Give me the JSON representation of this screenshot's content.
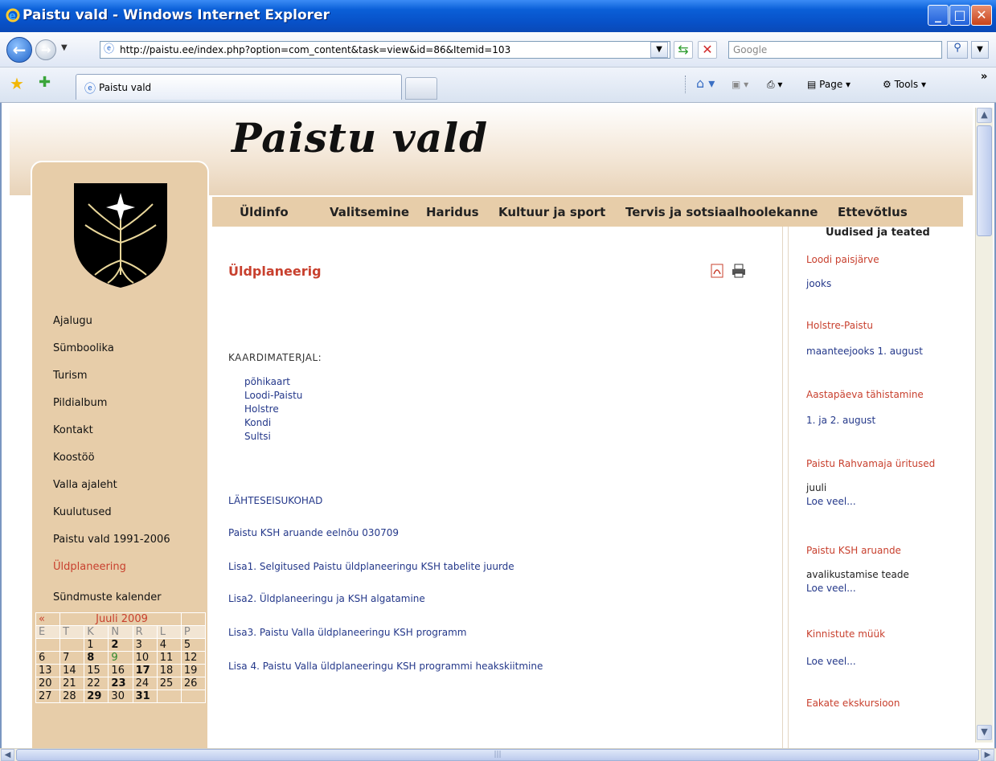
{
  "window": {
    "title": "Paistu vald - Windows Internet Explorer"
  },
  "address_bar": {
    "url": "http://paistu.ee/index.php?option=com_content&task=view&id=86&Itemid=103",
    "search_placeholder": "Google"
  },
  "tabs": {
    "active_label": "Paistu vald"
  },
  "command_bar": {
    "page_label": "Page",
    "tools_label": "Tools"
  },
  "site": {
    "title": "Paistu vald"
  },
  "top_nav": [
    "Üldinfo",
    "Valitsemine",
    "Haridus",
    "Kultuur ja sport",
    "Tervis ja sotsiaalhoolekanne",
    "Ettevõtlus"
  ],
  "left_menu": {
    "items": [
      "Ajalugu",
      "Sümboolika",
      "Turism",
      "Pildialbum",
      "Kontakt",
      "Koostöö",
      "Valla ajaleht",
      "Kuulutused",
      "Paistu vald 1991-2006",
      "Üldplaneering",
      "Sündmuste kalender"
    ],
    "active": "Üldplaneering"
  },
  "calendar": {
    "prev": "«",
    "month": "Juuli 2009",
    "weekdays": [
      "E",
      "T",
      "K",
      "N",
      "R",
      "L",
      "P"
    ],
    "weeks": [
      [
        "",
        "",
        "1",
        "2",
        "3",
        "4",
        "5"
      ],
      [
        "6",
        "7",
        "8",
        "9",
        "10",
        "11",
        "12"
      ],
      [
        "13",
        "14",
        "15",
        "16",
        "17",
        "18",
        "19"
      ],
      [
        "20",
        "21",
        "22",
        "23",
        "24",
        "25",
        "26"
      ],
      [
        "27",
        "28",
        "29",
        "30",
        "31",
        "",
        ""
      ]
    ]
  },
  "article": {
    "title": "Üldplaneerig",
    "maps_heading": "KAARDIMATERJAL:",
    "map_links": [
      "põhikaart",
      "Loodi-Paistu",
      "Holstre",
      "Kondi",
      "Sultsi"
    ],
    "doc_links": [
      "LÄHTESEISUKOHAD",
      "Paistu KSH aruande eelnõu 030709",
      "Lisa1. Selgitused Paistu üldplaneeringu KSH tabelite juurde",
      "Lisa2. Üldplaneeringu ja KSH algatamine",
      "Lisa3.  Paistu Valla üldplaneeringu KSH programm",
      "Lisa 4. Paistu Valla üldplaneeringu KSH programmi heakskiitmine"
    ]
  },
  "news": {
    "heading": "Uudised ja teated",
    "items": [
      {
        "text": "Loodi paisjärve",
        "style": "red"
      },
      {
        "text": "jooks",
        "style": "blue"
      },
      {
        "text": "Holstre-Paistu",
        "style": "red"
      },
      {
        "text": "maanteejooks 1. august",
        "style": "blue"
      },
      {
        "text": "Aastapäeva tähistamine",
        "style": "red"
      },
      {
        "text": "1. ja 2. august",
        "style": "blue"
      },
      {
        "text": "Paistu Rahvamaja üritused",
        "style": "red"
      },
      {
        "text": "juuli",
        "style": "dark"
      },
      {
        "text": "Loe veel...",
        "style": "blue"
      },
      {
        "text": "Paistu KSH aruande",
        "style": "red"
      },
      {
        "text": "avalikustamise teade",
        "style": "dark"
      },
      {
        "text": "Loe veel...",
        "style": "blue"
      },
      {
        "text": "Kinnistute müük",
        "style": "red"
      },
      {
        "text": "Loe veel...",
        "style": "blue"
      },
      {
        "text": "Eakate ekskursioon",
        "style": "red"
      }
    ]
  },
  "colors": {
    "accent_red": "#c8402e",
    "link_blue": "#24388a",
    "tan": "#e7cda9"
  }
}
